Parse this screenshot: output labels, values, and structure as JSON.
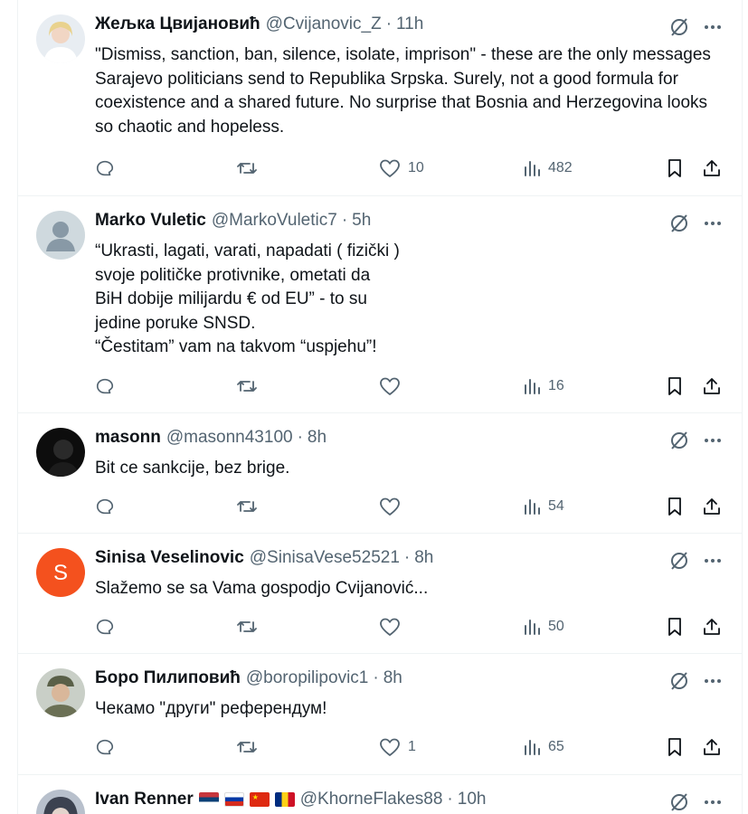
{
  "tweets": [
    {
      "name": "Жељка Цвијановић",
      "handle": "@Cvijanovic_Z",
      "time": "11h",
      "text": "\"Dismiss, sanction, ban, silence, isolate, imprison\" - these are the only messages Sarajevo politicians send to Republika Srpska. Surely, not a good formula for coexistence and a shared future. No surprise that Bosnia and Herzegovina looks so chaotic and hopeless.",
      "likes": "10",
      "views": "482"
    },
    {
      "name": "Marko Vuletic",
      "handle": "@MarkoVuletic7",
      "time": "5h",
      "text": "“Ukrasti, lagati, varati, napadati ( fizički )\nsvoje političke protivnike, ometati da\nBiH dobije milijardu € od EU” - to su\njedine poruke SNSD.\n“Čestitam” vam na takvom “uspjehu”!",
      "likes": "",
      "views": "16"
    },
    {
      "name": "masonn",
      "handle": "@masonn43100",
      "time": "8h",
      "text": "Bit ce sankcije, bez brige.",
      "likes": "",
      "views": "54"
    },
    {
      "name": "Sinisa Veselinovic",
      "handle": "@SinisaVese52521",
      "time": "8h",
      "text": "Slažemo se sa Vama gospodjo Cvijanović...",
      "likes": "",
      "views": "50",
      "avatar_letter": "S"
    },
    {
      "name": "Боро Пилиповић",
      "handle": "@boropilipovic1",
      "time": "8h",
      "text": "Чекамо \"други\" референдум!",
      "likes": "1",
      "views": "65"
    },
    {
      "name": "Ivan Renner",
      "handle": "@KhorneFlakes88",
      "time": "10h",
      "flags": [
        "serbia-flag",
        "russia-flag",
        "china-flag",
        "romania-flag"
      ]
    }
  ],
  "separator": "·",
  "colors": {
    "text": "#0f1419",
    "secondary": "#536471",
    "border": "#eff3f4",
    "avatar_orange": "#f4511e"
  }
}
